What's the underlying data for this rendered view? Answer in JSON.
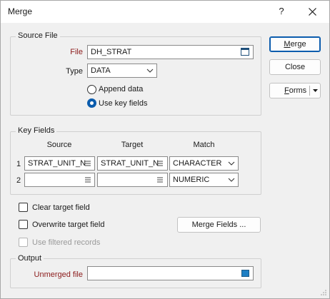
{
  "window": {
    "title": "Merge",
    "help_glyph": "?"
  },
  "source_file": {
    "legend": "Source File",
    "file_label": "File",
    "file_value": "DH_STRAT",
    "type_label": "Type",
    "type_value": "DATA",
    "append_label": "Append data",
    "use_key_label": "Use key fields",
    "selected_mode": "use_key_fields"
  },
  "key_fields": {
    "legend": "Key Fields",
    "headers": {
      "source": "Source",
      "target": "Target",
      "match": "Match"
    },
    "rows": [
      {
        "num": "1",
        "source": "STRAT_UNIT_N",
        "target": "STRAT_UNIT_N",
        "match": "CHARACTER"
      },
      {
        "num": "2",
        "source": "",
        "target": "",
        "match": "NUMERIC"
      }
    ]
  },
  "options": {
    "clear_target_label": "Clear target field",
    "overwrite_target_label": "Overwrite target field",
    "use_filtered_label": "Use filtered records",
    "merge_fields_label": "Merge Fields ..."
  },
  "output": {
    "legend": "Output",
    "unmerged_label": "Unmerged file",
    "unmerged_value": ""
  },
  "buttons": {
    "merge_first": "M",
    "merge_rest": "erge",
    "close": "Close",
    "forms_first": "F",
    "forms_rest": "orms"
  },
  "colors": {
    "accent": "#0b5cad",
    "required_label": "#8b1a1a",
    "browse_square": "#1e7fc4"
  },
  "icons": [
    "close-icon",
    "folder-browse-icon",
    "chevron-down-icon",
    "list-icon",
    "dropdown-arrow-icon",
    "size-grip-icon"
  ]
}
